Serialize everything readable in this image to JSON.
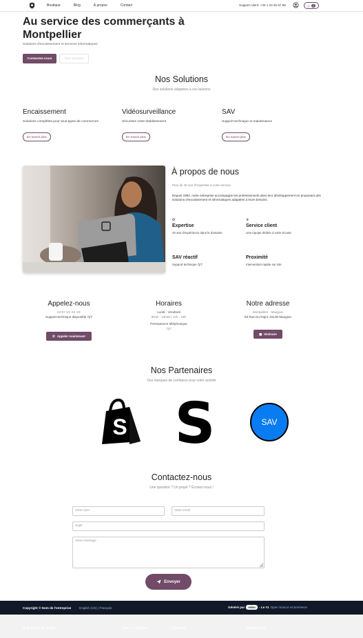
{
  "nav": {
    "links": [
      "Boutique",
      "Blog",
      "À propos",
      "Contact"
    ],
    "support": "Support client: +33 1 23 45 67 89",
    "cart_count": "0"
  },
  "hero": {
    "title": "Au service des commerçants à Montpellier",
    "subtitle": "Solutions d'encaissement et services informatiques",
    "primary_btn": "Contactez-nous",
    "secondary_btn": "Nos services"
  },
  "solutions": {
    "title": "Nos Solutions",
    "subtitle": "Des solutions adaptées à vos besoins",
    "items": [
      {
        "title": "Encaissement",
        "desc": "Solutions complètes pour tous types de commerces",
        "btn": "En savoir plus"
      },
      {
        "title": "Vidéosurveillance",
        "desc": "Sécurisez votre établissement",
        "btn": "En savoir plus"
      },
      {
        "title": "SAV",
        "desc": "Support technique et maintenance",
        "btn": "En savoir plus"
      }
    ]
  },
  "about": {
    "title": "À propos de nous",
    "lead": "Plus de 40 ans d'expertise à votre service",
    "text": "Depuis 1982, notre entreprise accompagne les professionnels dans leur développement en proposant des solutions d'encaissement et informatiques adaptées à leurs besoins.",
    "features": [
      {
        "icon": "✪",
        "title": "Expertise",
        "desc": "40 ans d'expérience dans le domaine"
      },
      {
        "icon": "♛",
        "title": "Service client",
        "desc": "Une équipe dédiée à votre écoute"
      },
      {
        "icon": "",
        "title": "SAV réactif",
        "desc": "Support technique 7j/7"
      },
      {
        "icon": "",
        "title": "Proximité",
        "desc": "Intervention rapide sur site"
      }
    ]
  },
  "info": {
    "call": {
      "title": "Appelez-nous",
      "phone": "04 67 XX XX XX",
      "desc": "Support technique disponible 7j/7",
      "btn": "Appeler maintenant"
    },
    "hours": {
      "title": "Horaires",
      "days": "Lundi - Vendredi",
      "times": "8h30 - 12h30 | 14h - 18h",
      "phone_label": "Permanence téléphonique",
      "phone_hours": "7j/7"
    },
    "address": {
      "title": "Notre adresse",
      "city": "Montpellier - Mauguio",
      "street": "93 Rue Du Rajol, 34130 Mauguio",
      "btn": "Itinéraire"
    }
  },
  "partners": {
    "title": "Nos Partenaires",
    "subtitle": "Des marques de confiance pour votre activité",
    "sav_label": "SAV"
  },
  "contact": {
    "title": "Contactez-nous",
    "subtitle": "Une question ? Un projet ? Écrivez-nous !",
    "name_ph": "Votre nom",
    "email_ph": "Votre email",
    "subject_ph": "Sujet",
    "message_ph": "Votre message",
    "send_btn": "Envoyer"
  },
  "footer": {
    "copyright": "Copyright © Nom de l'entreprise",
    "lang": "English (US)   |   Français",
    "powered_prefix": "Généré par",
    "powered_brand": "odoo",
    "powered_mid": "- Le #1",
    "powered_link": "Open Source eCommerce",
    "bottom_cols": [
      "À propos de nous",
      "Liens rapides",
      "Contact",
      "Newsletter"
    ]
  },
  "colors": {
    "accent": "#714b67",
    "footer": "#111827",
    "sav": "#0a7cf2"
  }
}
